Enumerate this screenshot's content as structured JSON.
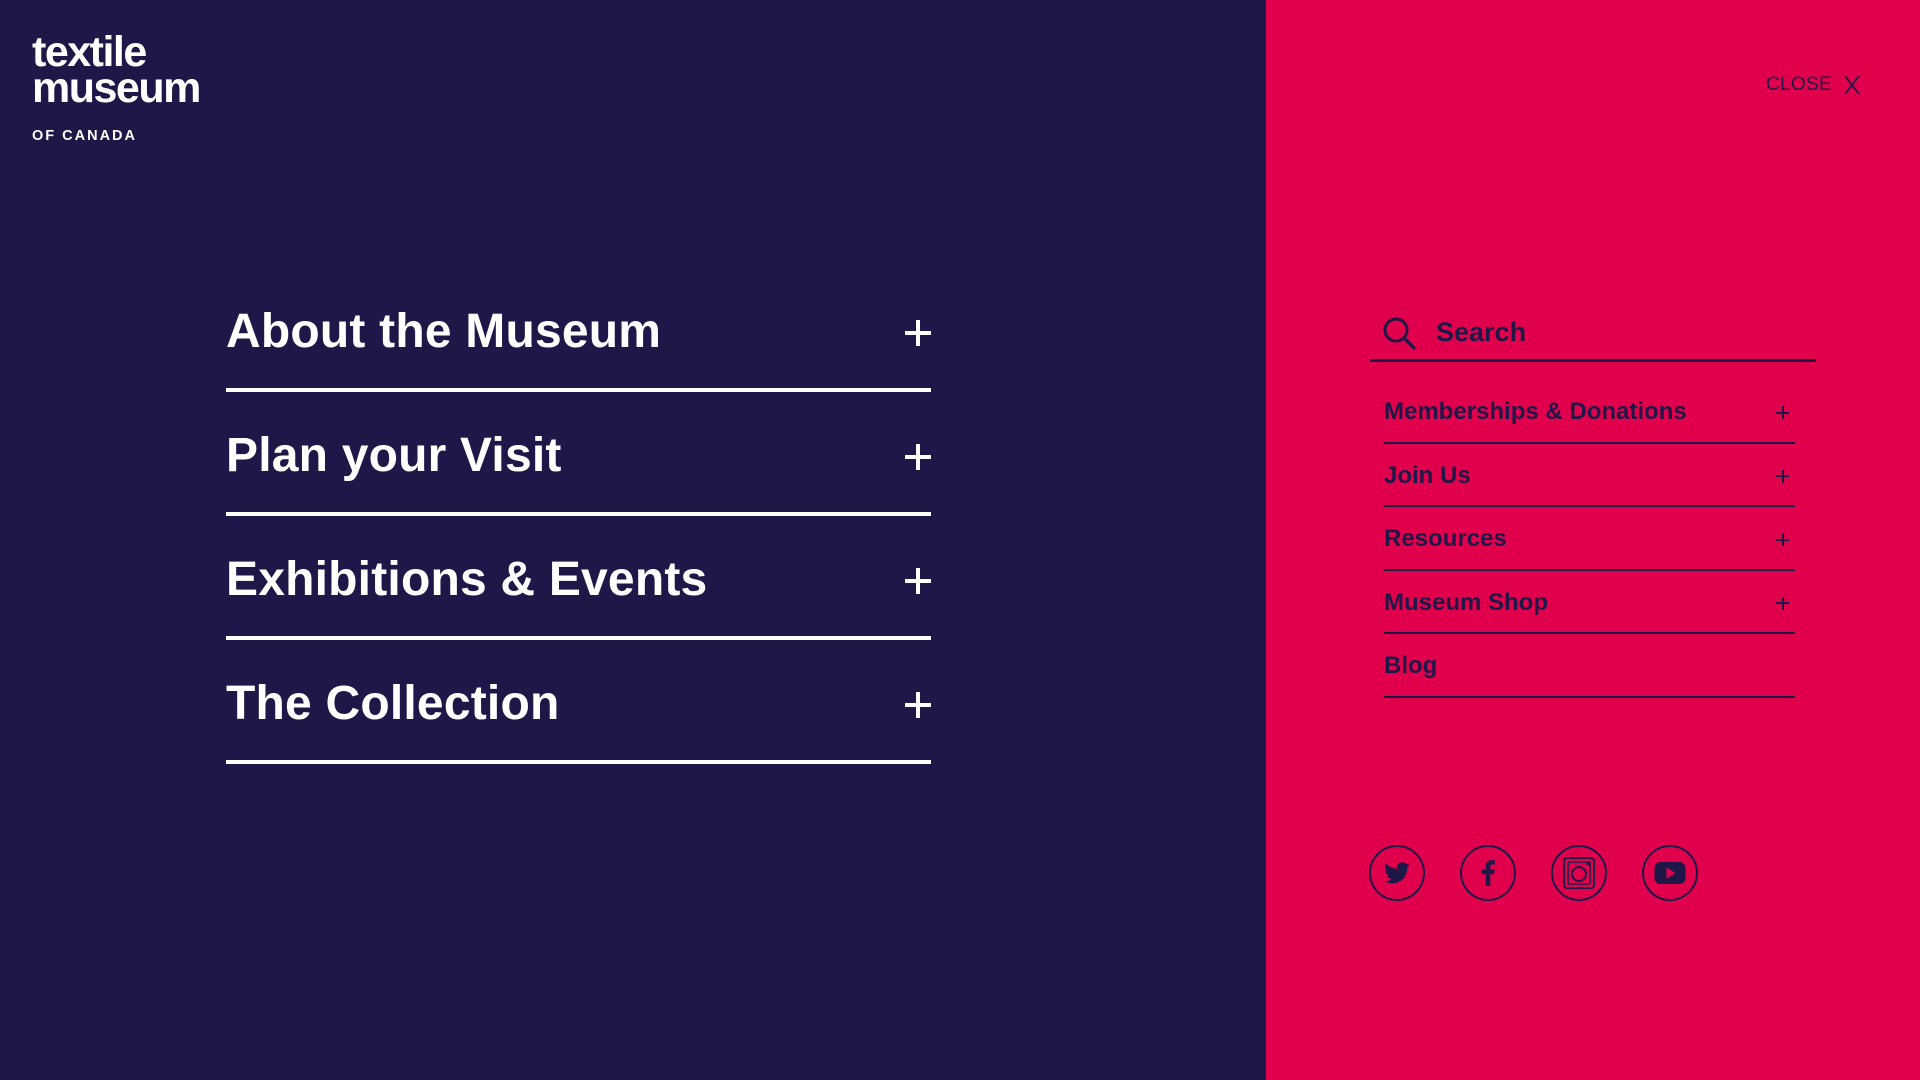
{
  "logo": {
    "line1": "textile",
    "line2": "museum",
    "sub": "OF CANADA"
  },
  "close": {
    "label": "CLOSE"
  },
  "main_nav": {
    "items": [
      {
        "label": "About the Museum"
      },
      {
        "label": "Plan your Visit"
      },
      {
        "label": "Exhibitions & Events"
      },
      {
        "label": "The Collection"
      }
    ]
  },
  "search": {
    "placeholder": "Search",
    "value": ""
  },
  "secondary_nav": {
    "items": [
      {
        "label": "Memberships & Donations",
        "expandable": true
      },
      {
        "label": "Join Us",
        "expandable": true
      },
      {
        "label": "Resources",
        "expandable": true
      },
      {
        "label": "Museum Shop",
        "expandable": true
      },
      {
        "label": "Blog",
        "expandable": false
      }
    ]
  },
  "social": [
    "twitter-icon",
    "facebook-icon",
    "instagram-icon",
    "youtube-icon"
  ],
  "colors": {
    "navy": "#1e1748",
    "crimson": "#e0004b",
    "white": "#ffffff"
  }
}
